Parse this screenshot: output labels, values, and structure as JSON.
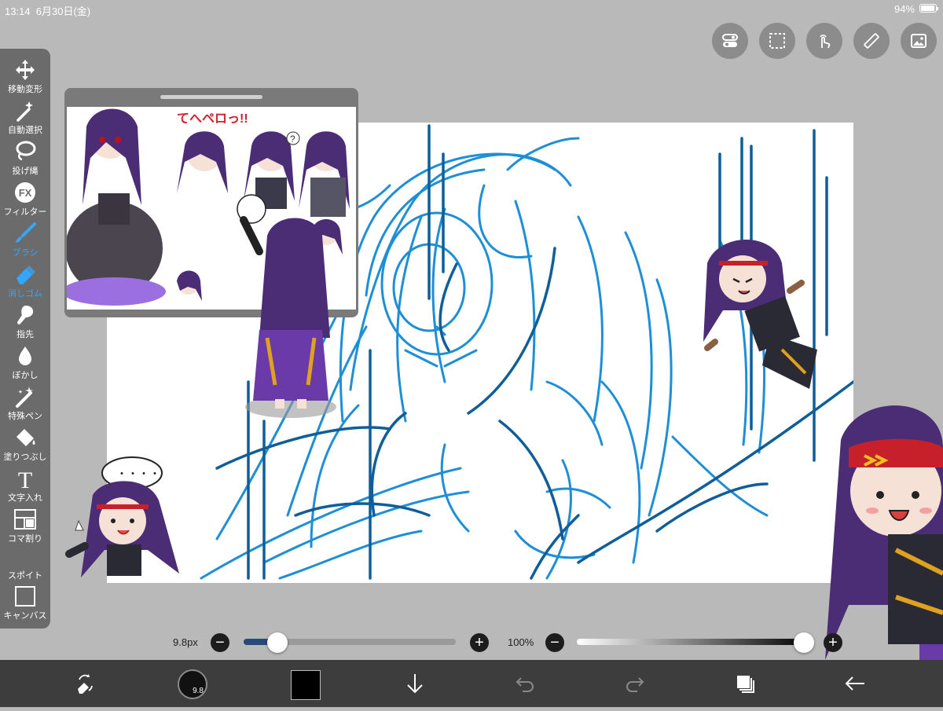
{
  "status": {
    "time": "13:14",
    "date": "6月30日(金)",
    "battery": "94%"
  },
  "top_buttons": [
    "toggle-icon",
    "selection-icon",
    "touch-icon",
    "ruler-icon",
    "image-icon"
  ],
  "tools": [
    {
      "label": "移動変形",
      "icon": "move-icon"
    },
    {
      "label": "自動選択",
      "icon": "magic-wand-icon"
    },
    {
      "label": "投げ縄",
      "icon": "lasso-icon"
    },
    {
      "label": "フィルター",
      "icon": "filter-icon"
    },
    {
      "label": "ブラシ",
      "icon": "brush-icon",
      "active": true
    },
    {
      "label": "消しゴム",
      "icon": "eraser-icon",
      "active": true
    },
    {
      "label": "指先",
      "icon": "finger-icon"
    },
    {
      "label": "ぼかし",
      "icon": "blur-icon"
    },
    {
      "label": "特殊ペン",
      "icon": "special-pen-icon"
    },
    {
      "label": "塗りつぶし",
      "icon": "fill-icon"
    },
    {
      "label": "文字入れ",
      "icon": "text-icon"
    },
    {
      "label": "コマ割り",
      "icon": "frame-divider-icon"
    },
    {
      "label": "スポイト",
      "icon": "eyedropper-icon"
    },
    {
      "label": "キャンバス",
      "icon": "canvas-icon"
    }
  ],
  "filter_glyph": "FX",
  "text_glyph": "T",
  "sliders": {
    "size_label": "9.8px",
    "size_value_fraction": 0.16,
    "opacity_label": "100%",
    "opacity_value_fraction": 1.0
  },
  "bottom": {
    "brush_size_label": "9.8",
    "current_color": "#000000"
  },
  "reference_image": {
    "bubble_text": "・・・・",
    "question": "?",
    "exclaim_text": "てへペロっ!!"
  },
  "colors": {
    "accent": "#35a6ff",
    "sketch_blue": "#1e8fd6",
    "sketch_dark": "#0f5e9a"
  }
}
